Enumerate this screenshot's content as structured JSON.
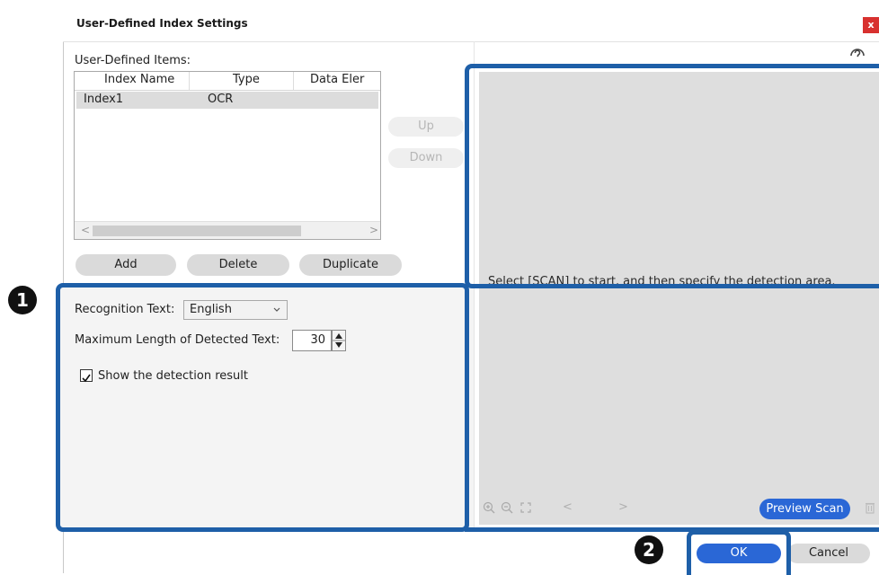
{
  "window": {
    "title": "User-Defined Index Settings",
    "close_glyph": "x"
  },
  "items": {
    "label": "User-Defined Items:",
    "columns": [
      "Index Name",
      "Type",
      "Data Eler"
    ],
    "rows": [
      {
        "name": "Index1",
        "type": "OCR",
        "data": ""
      }
    ],
    "scroll_left": "<",
    "scroll_right": ">"
  },
  "reorder": {
    "up": "Up",
    "down": "Down"
  },
  "actions": {
    "add": "Add",
    "delete": "Delete",
    "duplicate": "Duplicate"
  },
  "settings": {
    "recognition_label": "Recognition Text:",
    "recognition_value": "English",
    "max_length_label": "Maximum Length of Detected Text:",
    "max_length_value": "30",
    "show_result_label": "Show the detection result",
    "show_result_checked": true
  },
  "preview": {
    "message": "Select [SCAN] to start, and then specify the detection area.",
    "prev": "<",
    "next": ">",
    "scan_button": "Preview Scan"
  },
  "footer": {
    "ok": "OK",
    "cancel": "Cancel"
  },
  "callouts": {
    "one": "1",
    "two": "2"
  },
  "colors": {
    "accent": "#2a67d6",
    "callout": "#1e5fa8",
    "close": "#d8312f"
  }
}
